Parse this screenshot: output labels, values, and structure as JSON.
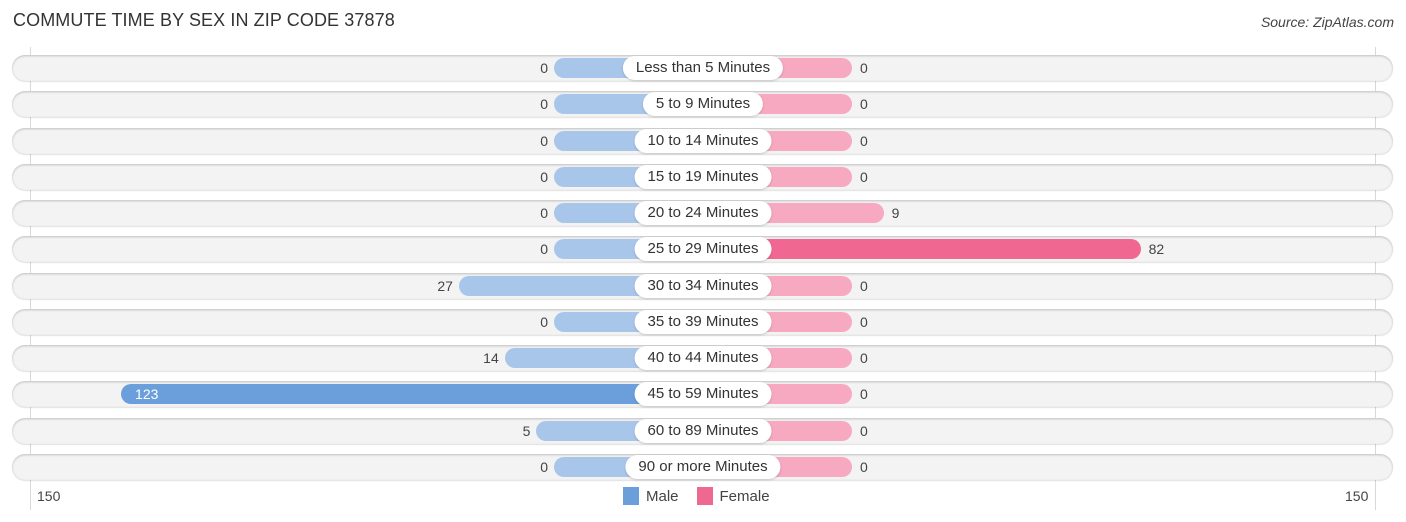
{
  "header": {
    "title": "COMMUTE TIME BY SEX IN ZIP CODE 37878",
    "source": "Source: ZipAtlas.com"
  },
  "legend": [
    {
      "name": "Male",
      "color": "#6a9fdc"
    },
    {
      "name": "Female",
      "color": "#f06891"
    }
  ],
  "axis": {
    "left_label": "150",
    "right_label": "150"
  },
  "colors": {
    "male_light": "#a8c6ea",
    "male_strong": "#6a9fdc",
    "female_light": "#f6a9c1",
    "female_strong": "#f06891",
    "row_background": "#f3f3f3"
  },
  "chart_data": {
    "type": "bar",
    "orientation": "horizontal-diverging",
    "title": "COMMUTE TIME BY SEX IN ZIP CODE 37878",
    "xlabel": "",
    "ylabel": "",
    "xlim": [
      -150,
      150
    ],
    "tick_labels": [
      "150",
      "150"
    ],
    "legend_position": "bottom-center",
    "categories": [
      "Less than 5 Minutes",
      "5 to 9 Minutes",
      "10 to 14 Minutes",
      "15 to 19 Minutes",
      "20 to 24 Minutes",
      "25 to 29 Minutes",
      "30 to 34 Minutes",
      "35 to 39 Minutes",
      "40 to 44 Minutes",
      "45 to 59 Minutes",
      "60 to 89 Minutes",
      "90 or more Minutes"
    ],
    "series": [
      {
        "name": "Male",
        "side": "left",
        "values": [
          0,
          0,
          0,
          0,
          0,
          0,
          27,
          0,
          14,
          123,
          5,
          0
        ]
      },
      {
        "name": "Female",
        "side": "right",
        "values": [
          0,
          0,
          0,
          0,
          9,
          82,
          0,
          0,
          0,
          0,
          0,
          0
        ]
      }
    ]
  }
}
